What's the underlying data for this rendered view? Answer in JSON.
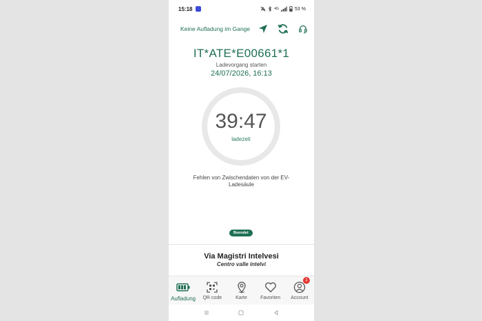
{
  "status_bar": {
    "time": "15:18",
    "battery": "53 %",
    "network": "4G"
  },
  "header": {
    "status_text": "Keine Aufladung im Gange"
  },
  "session": {
    "station_id": "IT*ATE*E00661*1",
    "label": "Ladevorgang starten",
    "datetime": "24/07/2026, 16:13",
    "timer": "39:47",
    "timer_label": "ladezeit",
    "message": "Fehlen von Zwischendaten von der EV-Ladesäule",
    "status_badge": "Beendet"
  },
  "location": {
    "name": "Via Magistri Intelvesi",
    "subtitle": "Centro valle intelvi"
  },
  "tabs": [
    {
      "label": "Aufladung",
      "icon": "battery-icon",
      "active": true
    },
    {
      "label": "QR code",
      "icon": "qr-code-icon"
    },
    {
      "label": "Karte",
      "icon": "map-pin-icon"
    },
    {
      "label": "Favoriten",
      "icon": "heart-icon"
    },
    {
      "label": "Account",
      "icon": "account-icon",
      "badge": "1"
    }
  ],
  "colors": {
    "accent": "#1f6f55",
    "badge_red": "#e53935",
    "ring": "#e8e8e8"
  }
}
